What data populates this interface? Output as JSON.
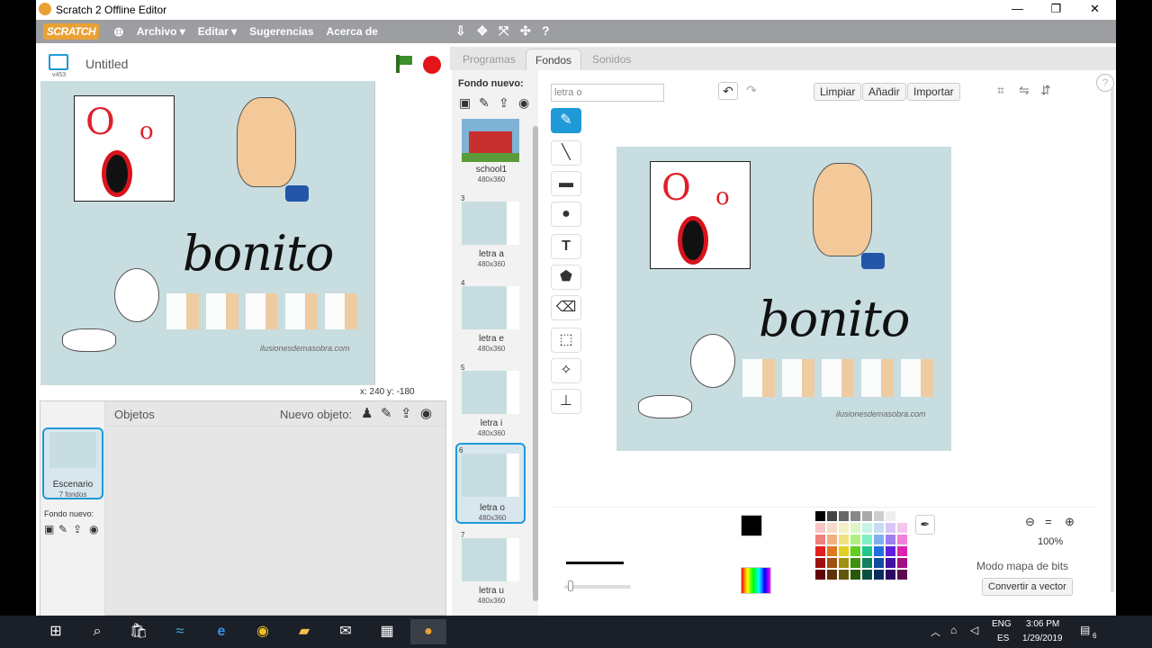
{
  "window": {
    "title": "Scratch 2 Offline Editor"
  },
  "menu": {
    "logo": "SCRATCH",
    "items": [
      "Archivo ▾",
      "Editar ▾",
      "Sugerencias",
      "Acerca de"
    ]
  },
  "stage": {
    "project_title": "Untitled",
    "version": "v453",
    "coords": "x: 240  y: -180"
  },
  "sprites": {
    "header": "Objetos",
    "new_sprite": "Nuevo objeto:",
    "stage_name": "Escenario",
    "stage_count": "7 fondos",
    "new_backdrop": "Fondo nuevo:"
  },
  "tabs": [
    "Programas",
    "Fondos",
    "Sonidos"
  ],
  "backdrops": {
    "label": "Fondo nuevo:",
    "items": [
      {
        "index": "",
        "name": "school1",
        "size": "480x360"
      },
      {
        "index": "3",
        "name": "letra a",
        "size": "480x360"
      },
      {
        "index": "4",
        "name": "letra e",
        "size": "480x360"
      },
      {
        "index": "5",
        "name": "letra i",
        "size": "480x360"
      },
      {
        "index": "6",
        "name": "letra o",
        "size": "480x360"
      },
      {
        "index": "7",
        "name": "letra u",
        "size": "480x360"
      }
    ]
  },
  "editor": {
    "name_value": "letra o",
    "clear": "Limpiar",
    "add": "Añadir",
    "import": "Importar",
    "zoom": "100%",
    "mode": "Modo mapa de bits",
    "convert": "Convertir a vector"
  },
  "artwork": {
    "word": "bonito",
    "watermark": "ilusionesdemasobra.com",
    "big_letter": "O",
    "small_letter": "o"
  },
  "taskbar": {
    "lang": "ENG",
    "lang2": "ES",
    "time": "3:06 PM",
    "date": "1/29/2019",
    "notif": "6"
  },
  "colors": {
    "menubar": "#9c9ea2",
    "accent": "#1e9ad8",
    "flag": "#3d8f2a",
    "stop": "#e4141b",
    "text_red": "#e0202a"
  }
}
